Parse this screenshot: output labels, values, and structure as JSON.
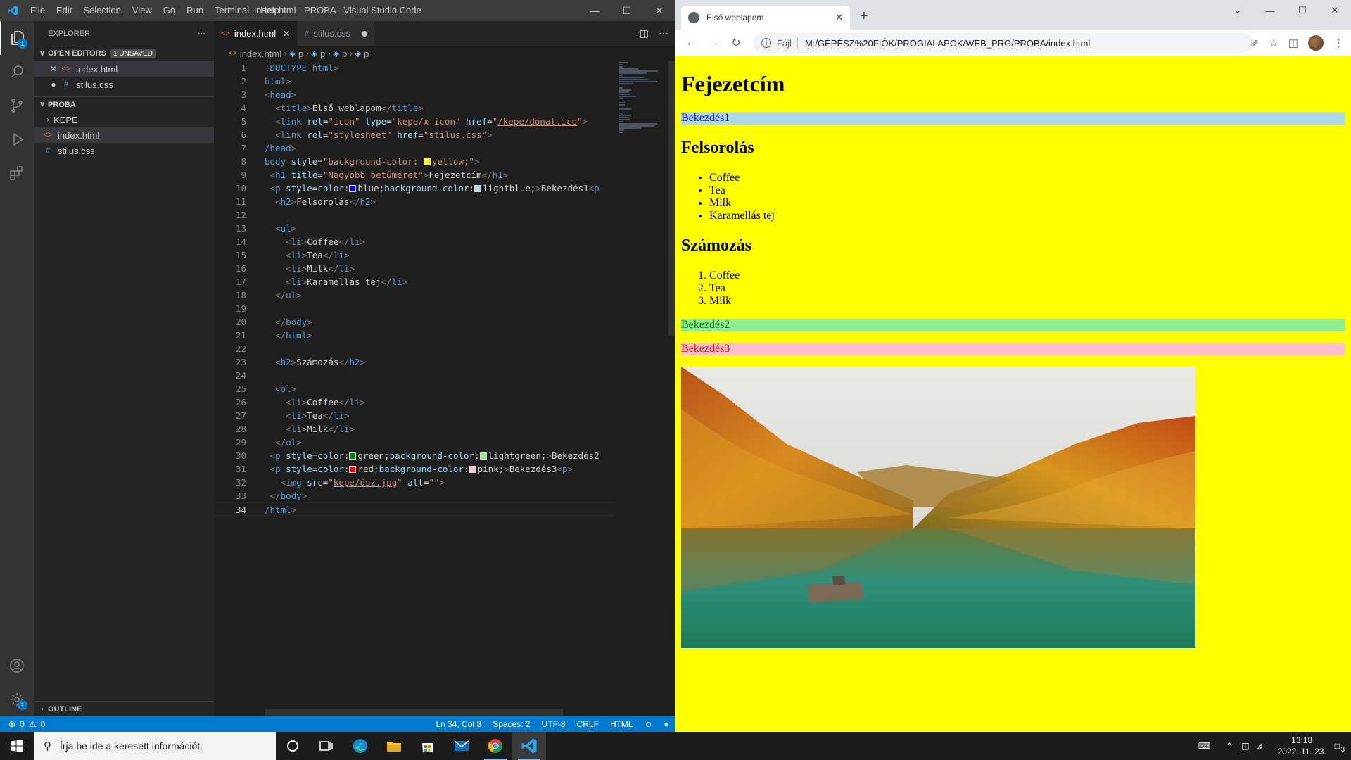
{
  "vscode": {
    "title": "index.html - PROBA - Visual Studio Code",
    "menu": [
      "File",
      "Edit",
      "Selection",
      "View",
      "Go",
      "Run",
      "Terminal",
      "Help"
    ],
    "explorer": {
      "header": "EXPLORER",
      "open_editors_label": "OPEN EDITORS",
      "unsaved_badge": "1 UNSAVED",
      "open_editors": [
        "index.html",
        "stilus.css"
      ],
      "project_label": "PROBA",
      "folder": "KEPE",
      "files": [
        "index.html",
        "stilus.css"
      ],
      "outline_label": "OUTLINE"
    },
    "tabs": [
      {
        "label": "index.html",
        "active": true
      },
      {
        "label": "stilus.css",
        "active": false
      }
    ],
    "breadcrumb": [
      "index.html",
      "p",
      "p",
      "p",
      "p"
    ],
    "code_lines": [
      "!DOCTYPE html>",
      "html>",
      "<head>",
      "  <title>Első weblapom</title>",
      "  <link rel=\"icon\" type=\"kepe/x-icon\" href=\"/kepe/donat.ico\">",
      "  <link rel=\"stylesheet\" href=\"stilus.css\">",
      "/head>",
      "body style=\"background-color: yellow;\">",
      " <h1 title=\"Nagyobb betűméret\">Fejezetcím</h1>",
      " <p style=color:blue;background-color:lightblue;>Bekezdés1<p",
      "  <h2>Felsorolás</h2>",
      "",
      "  <ul>",
      "    <li>Coffee</li>",
      "    <li>Tea</li>",
      "    <li>Milk</li>",
      "    <li>Karamellás tej</li>",
      "  </ul>",
      "",
      "  </body>",
      "  </html>",
      "",
      "  <h2>Számozás</h2>",
      "",
      "  <ol>",
      "    <li>Coffee</li>",
      "    <li>Tea</li>",
      "    <li>Milk</li>",
      "  </ol>",
      " <p style=color:green;background-color:lightgreen;>Bekezdés2",
      " <p style=color:red;background-color:pink;>Bekezdés3<p>",
      "   <img src=\"kepe/ősz.jpg\" alt=\"\">",
      " </body>",
      "/html>"
    ],
    "status": {
      "errors": "0",
      "warnings": "0",
      "position": "Ln 34, Col 8",
      "spaces": "Spaces: 2",
      "encoding": "UTF-8",
      "eol": "CRLF",
      "language": "HTML"
    },
    "accent": "#007acc"
  },
  "browser": {
    "tab_title": "Első weblapom",
    "address_prefix": "Fájl",
    "url": "M:/GÉPÉSZ%20FIÓK/PROGIALAPOK/WEB_PRG/PROBA/index.html",
    "page": {
      "background": "#ffff00",
      "h1": "Fejezetcím",
      "p1": "Bekezdés1",
      "h2_list": "Felsorolás",
      "ul_items": [
        "Coffee",
        "Tea",
        "Milk",
        "Karamellás tej"
      ],
      "h2_numbered": "Számozás",
      "ol_items": [
        "Coffee",
        "Tea",
        "Milk"
      ],
      "p2": "Bekezdés2",
      "p3": "Bekezdés3",
      "image": "autumn lake photo"
    }
  },
  "taskbar": {
    "search_placeholder": "Írja be ide a keresett információt.",
    "time": "13:18",
    "date": "2022. 11. 23.",
    "notification_count": "3"
  }
}
